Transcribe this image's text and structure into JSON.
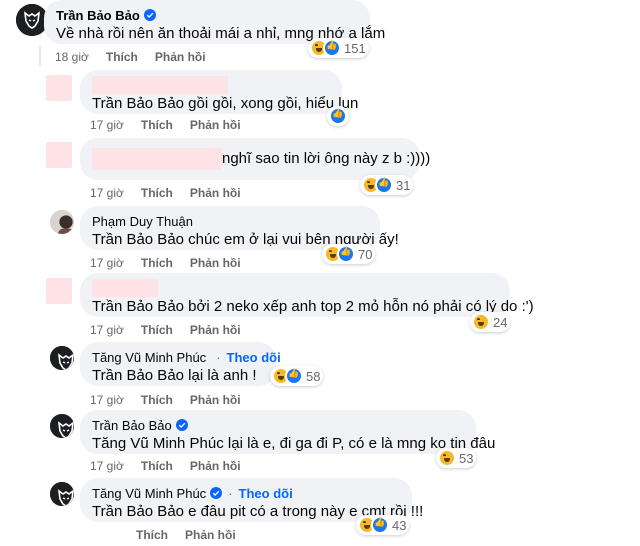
{
  "comments": [
    {
      "author": "Trần Bảo Bảo",
      "verified": true,
      "text": "Về nhà rồi nên ăn thoải mái a nhỉ, mng nhớ a lắm",
      "time": "18 giờ",
      "like": "Thích",
      "reply": "Phản hồi",
      "reactions": "151"
    },
    {
      "author": "",
      "mention": "Trần Bảo Bảo",
      "text": " gồi gồi, xong gồi, hiểu lun",
      "time": "17 giờ",
      "like": "Thích",
      "reply": "Phản hồi",
      "reactions": ""
    },
    {
      "author": "",
      "text": "nghĩ sao tin lời ông này z b :))))",
      "time": "17 giờ",
      "like": "Thích",
      "reply": "Phản hồi",
      "reactions": "31"
    },
    {
      "author": "Phạm Duy Thuận",
      "mention": "Trần Bảo Bảo",
      "text": " chúc em ở lại vui bên người ấy!",
      "time": "17 giờ",
      "like": "Thích",
      "reply": "Phản hồi",
      "reactions": "70"
    },
    {
      "author": "",
      "mention": "Trần Bảo Bảo",
      "text": " bởi 2 neko xếp anh top 2 mỏ hỗn nó phải có lý do :')",
      "time": "17 giờ",
      "like": "Thích",
      "reply": "Phản hồi",
      "reactions": "24"
    },
    {
      "author": "Tăng Vũ Minh Phúc",
      "verified": true,
      "follow": "Theo dõi",
      "mention": "Trần Bảo Bảo",
      "text": " lại là anh !",
      "time": "17 giờ",
      "like": "Thích",
      "reply": "Phản hồi",
      "reactions": "58"
    },
    {
      "author": "Trần Bảo Bảo",
      "verified": true,
      "mention": "Tăng Vũ Minh Phúc",
      "text": " lại là e, đi ga đi P, có e là mng ko tin đâu",
      "time": "17 giờ",
      "like": "Thích",
      "reply": "Phản hồi",
      "reactions": "53"
    },
    {
      "author": "Tăng Vũ Minh Phúc",
      "verified": true,
      "follow": "Theo dõi",
      "mention": "Trần Bảo Bảo",
      "text": " e đâu pit có a trong này e cmt rồi !!!",
      "time": "",
      "like": "Thích",
      "reply": "Phản hồi",
      "reactions": "43"
    }
  ],
  "colors": {
    "bubble": "#f0f2f5",
    "link": "#0866ff",
    "muted": "#65676b",
    "redaction": "#fde3e6"
  }
}
